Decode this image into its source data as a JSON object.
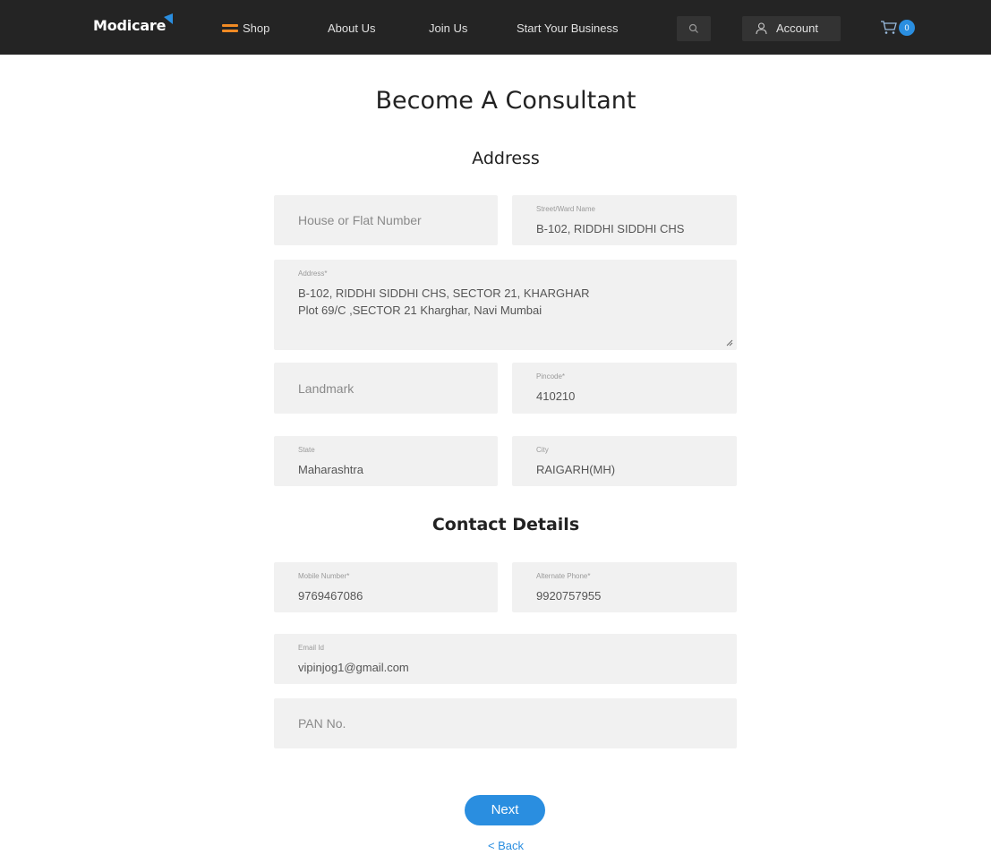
{
  "nav": {
    "logo_text": "Modicare",
    "shop_label": "Shop",
    "about_label": "About Us",
    "join_label": "Join Us",
    "business_label": "Start Your Business",
    "account_label": "Account",
    "cart_count": "0"
  },
  "page": {
    "title": "Become A Consultant",
    "address_heading": "Address",
    "contact_heading": "Contact Details"
  },
  "address": {
    "house_placeholder": "House or Flat Number",
    "street_label": "Street/Ward Name",
    "street_value": "B-102, RIDDHI SIDDHI CHS",
    "address_label": "Address*",
    "address_value": "B-102, RIDDHI SIDDHI CHS, SECTOR 21, KHARGHAR\nPlot 69/C ,SECTOR 21 Kharghar, Navi Mumbai",
    "landmark_placeholder": "Landmark",
    "pincode_label": "Pincode*",
    "pincode_value": "410210",
    "state_label": "State",
    "state_value": "Maharashtra",
    "city_label": "City",
    "city_value": "RAIGARH(MH)"
  },
  "contact": {
    "mobile_label": "Mobile Number*",
    "mobile_value": "9769467086",
    "alt_label": "Alternate Phone*",
    "alt_value": "9920757955",
    "email_label": "Email Id",
    "email_value": "vipinjog1@gmail.com",
    "pan_placeholder": "PAN No."
  },
  "actions": {
    "next_label": "Next",
    "back_label": "< Back"
  },
  "colors": {
    "nav_bg": "#242424",
    "accent": "#2a8ee0",
    "menu_icon": "#f08a24",
    "field_bg": "#f1f1f1"
  }
}
